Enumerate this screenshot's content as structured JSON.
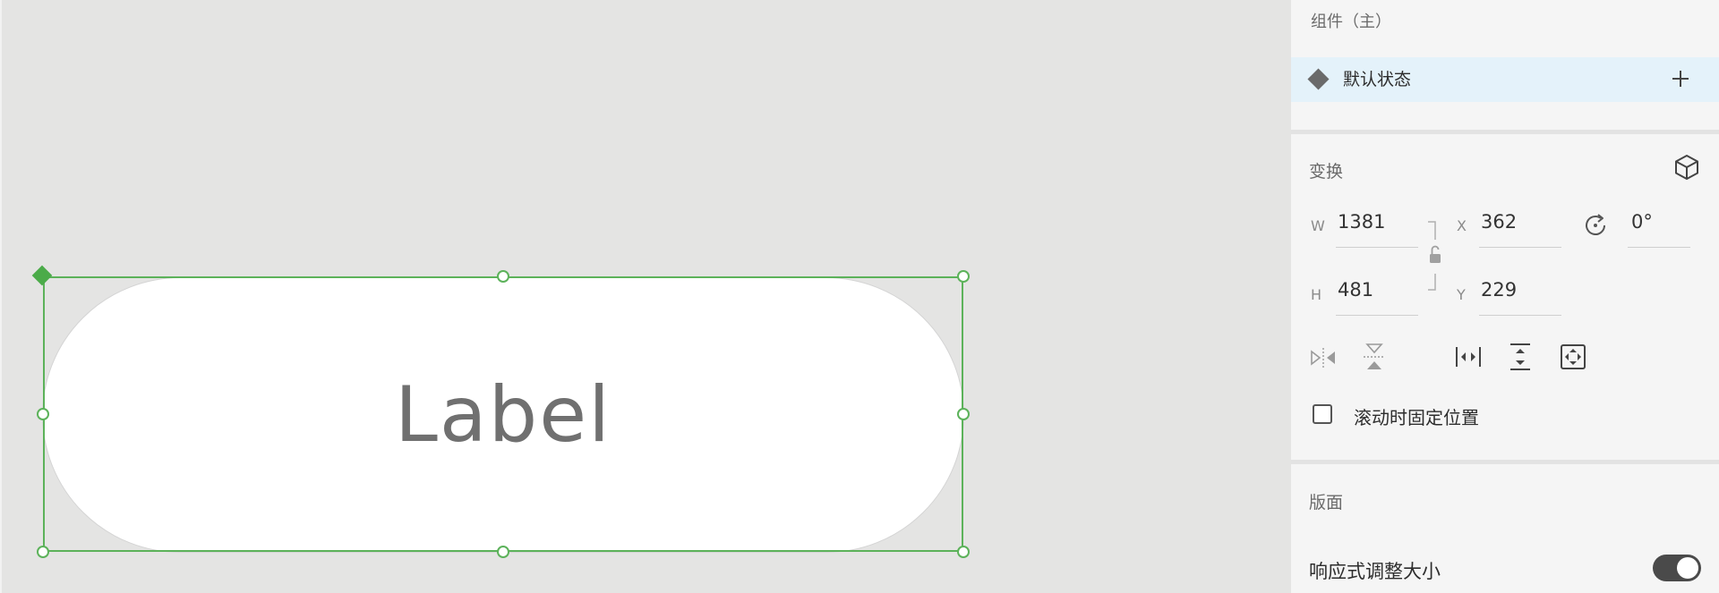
{
  "canvas": {
    "component_label": "Label"
  },
  "inspector": {
    "component_header": "组件（主）",
    "state": {
      "label": "默认状态",
      "add_icon": "plus-icon"
    },
    "transform": {
      "title": "变换",
      "cube_icon": "3d-cube-icon",
      "width_label": "W",
      "width_value": "1381",
      "x_label": "X",
      "x_value": "362",
      "height_label": "H",
      "height_value": "481",
      "y_label": "Y",
      "y_value": "229",
      "rotation_value": "0°",
      "icons": [
        "flip-horizontal-icon",
        "flip-vertical-icon",
        "distribute-horizontal-icon",
        "distribute-vertical-icon",
        "resize-fit-icon"
      ]
    },
    "fixed_position": {
      "label": "滚动时固定位置",
      "checked": false
    },
    "layout": {
      "title": "版面",
      "responsive_label": "响应式调整大小",
      "responsive_on": true
    }
  },
  "colors": {
    "selection": "#5cb25a",
    "state_row_bg": "#e4f2fa",
    "canvas_bg": "#e4e4e3",
    "panel_bg": "#f5f5f5"
  }
}
